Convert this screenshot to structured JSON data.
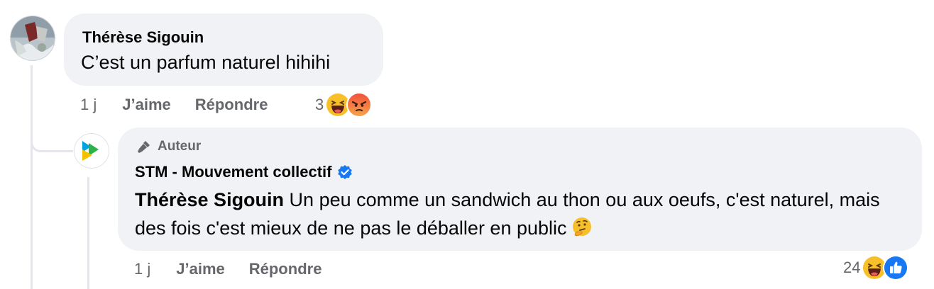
{
  "comment": {
    "author": "Thérèse Sigouin",
    "text": "C’est un parfum naturel hihihi",
    "time": "1 j",
    "like_label": "J’aime",
    "reply_label": "Répondre",
    "reaction_count": "3",
    "reaction_icons": [
      "haha-icon",
      "angry-icon"
    ]
  },
  "reply": {
    "badge": "Auteur",
    "author": "STM - Mouvement collectif",
    "verified": true,
    "mention": "Thérèse Sigouin",
    "text": " Un peu comme un sandwich au thon ou aux oeufs, c'est naturel, mais des fois c'est mieux de ne pas le déballer en public",
    "time": "1 j",
    "like_label": "J’aime",
    "reply_label": "Répondre",
    "reaction_count": "24",
    "reaction_icons": [
      "haha-icon",
      "like-icon"
    ]
  },
  "colors": {
    "bubble": "#f0f2f5",
    "secondary_text": "#65676b",
    "verified_blue": "#1877f2",
    "thread_line": "#e4e6eb"
  }
}
